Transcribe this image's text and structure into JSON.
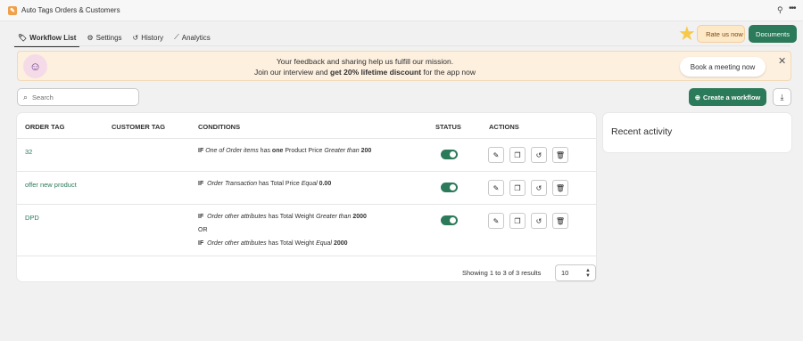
{
  "window": {
    "title": "Auto Tags Orders & Customers",
    "icons": [
      "pin-icon",
      "more-dots-icon"
    ]
  },
  "tabs": [
    {
      "label": "Workflow List",
      "icon": "tag-icon",
      "active": true
    },
    {
      "label": "Settings",
      "icon": "gear-icon",
      "active": false
    },
    {
      "label": "History",
      "icon": "history-icon",
      "active": false
    },
    {
      "label": "Analytics",
      "icon": "chart-icon",
      "active": false
    }
  ],
  "header_actions": {
    "rate_label": "Rate us now",
    "docs_label": "Documents"
  },
  "banner": {
    "line1": "Your feedback and sharing help us fulfill our mission.",
    "line2_prefix": "Join our interview and ",
    "line2_bold": "get 20% lifetime discount",
    "line2_suffix": " for the app now",
    "cta_label": "Book a meeting now"
  },
  "toolbar": {
    "search_placeholder": "Search",
    "create_label": "Create a workflow"
  },
  "table": {
    "headers": [
      "ORDER TAG",
      "CUSTOMER TAG",
      "CONDITIONS",
      "STATUS",
      "ACTIONS"
    ],
    "rows": [
      {
        "order_tag": "32",
        "customer_tag": "",
        "conditions": [
          {
            "if": "IF",
            "attr": "One of Order items",
            "op1": "has",
            "qty": "one",
            "field": "Product Price",
            "cmp": "Greater than",
            "value": "200"
          }
        ],
        "status_on": true
      },
      {
        "order_tag": "offer new product",
        "customer_tag": "",
        "conditions": [
          {
            "if": "IF",
            "attr": "Order Transaction",
            "op1": "has",
            "field": "Total Price",
            "cmp": "Equal",
            "value": "0.00"
          }
        ],
        "status_on": true
      },
      {
        "order_tag": "DPD",
        "customer_tag": "",
        "conditions": [
          {
            "if": "IF",
            "attr": "Order other attributes",
            "op1": "has",
            "field": "Total Weight",
            "cmp": "Greater than",
            "value": "2000"
          },
          {
            "joiner": "OR"
          },
          {
            "if": "IF",
            "attr": "Order other attributes",
            "op1": "has",
            "field": "Total Weight",
            "cmp": "Equal",
            "value": "2000"
          }
        ],
        "status_on": true
      }
    ],
    "action_icons": [
      "edit-icon",
      "duplicate-icon",
      "history-icon",
      "delete-icon"
    ],
    "footer": {
      "summary": "Showing 1 to 3 of 3 results",
      "page_size": "10"
    }
  },
  "recent_activity": {
    "title": "Recent activity"
  },
  "colors": {
    "primary": "#2b7a5a",
    "banner_bg": "#fdf0df",
    "rate_bg": "#fde8c8"
  }
}
